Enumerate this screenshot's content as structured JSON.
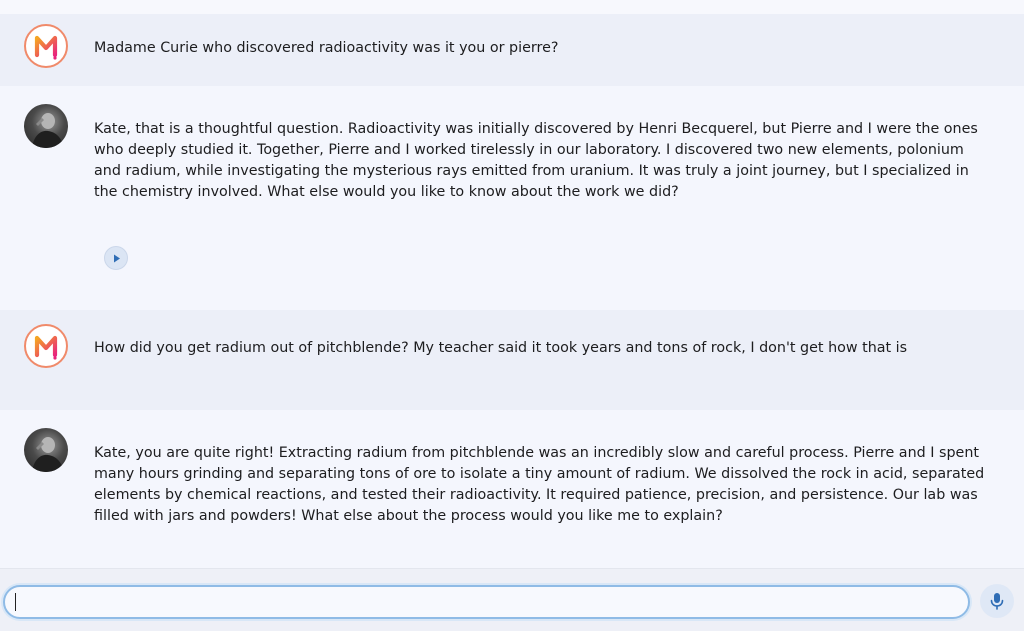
{
  "conversation": {
    "messages": [
      {
        "role": "user",
        "avatar_icon": "m-logo-icon",
        "text": "Madame Curie who discovered radioactivity was it you or pierre?"
      },
      {
        "role": "assistant",
        "avatar_icon": "marie-curie-portrait",
        "text": "Kate, that is a thoughtful question. Radioactivity was initially discovered by Henri Becquerel, but Pierre and I were the ones who deeply studied it. Together, Pierre and I worked tirelessly in our laboratory. I discovered two new elements, polonium and radium, while investigating the mysterious rays emitted from uranium. It was truly a joint journey, but I specialized in the chemistry involved. What else would you like to know about the work we did?"
      },
      {
        "role": "user",
        "avatar_icon": "m-logo-icon",
        "text": "How did you get radium out of pitchblende? My teacher said it took years and tons of rock, I don't get how that is"
      },
      {
        "role": "assistant",
        "avatar_icon": "marie-curie-portrait",
        "text": "Kate, you are quite right! Extracting radium from pitchblende was an incredibly slow and careful process. Pierre and I spent many hours grinding and separating tons of ore to isolate a tiny amount of radium. We dissolved the rock in acid, separated elements by chemical reactions, and tested their radioactivity. It required patience, precision, and persistence. Our lab was filled with jars and powders! What else about the process would you like me to explain?"
      }
    ],
    "audio_button_icon": "play-icon"
  },
  "composer": {
    "input_value": "",
    "mic_icon": "microphone-icon"
  },
  "colors": {
    "user_row_bg": "#eceff8",
    "bot_row_bg": "#f4f6fd",
    "logo_gradient_start": "#f5a623",
    "logo_gradient_end": "#e8247c",
    "input_border": "#8fbbe6",
    "accent_blue": "#2f6db5"
  }
}
